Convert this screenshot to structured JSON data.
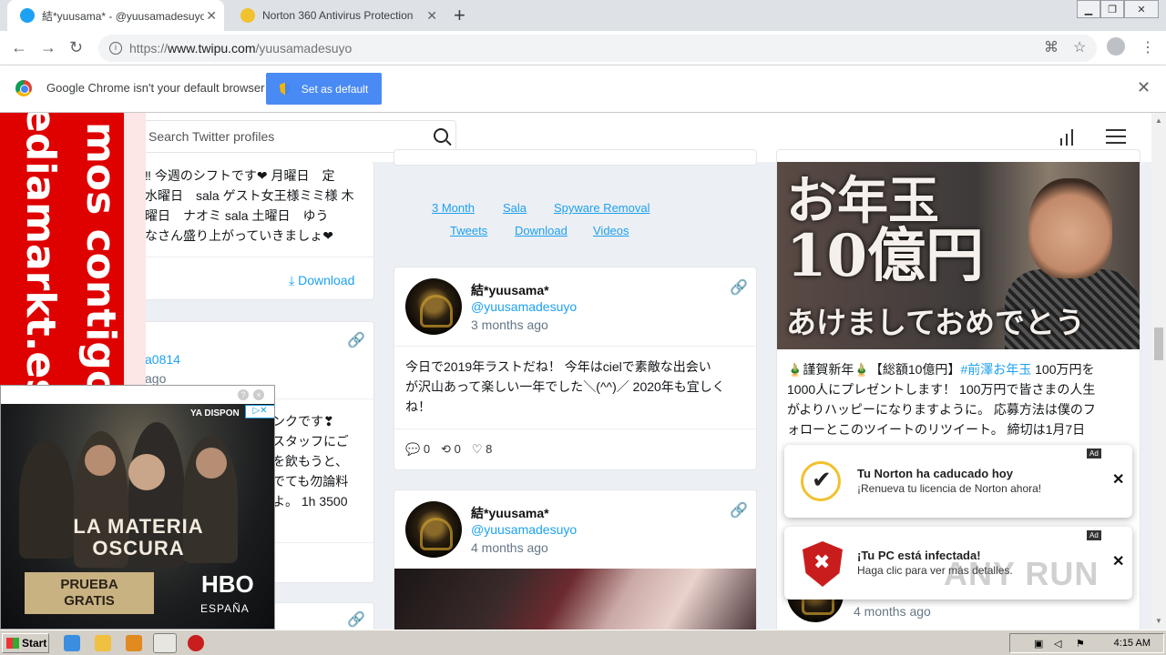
{
  "browser": {
    "tabs": [
      {
        "title": "結*yuusama* - @yuusamadesuyo T"
      },
      {
        "title": "Norton 360 Antivirus Protection"
      }
    ],
    "url": {
      "protocol": "https://",
      "host": "www.twipu.com",
      "path": "/yuusamadesuyo"
    },
    "infobar": {
      "message": "Google Chrome isn't your default browser",
      "button": "Set as default"
    }
  },
  "site": {
    "search_placeholder": "Search Twitter profiles",
    "nav_links_row1": [
      "3 Month",
      "Sala",
      "Spyware Removal"
    ],
    "nav_links_row2": [
      "Tweets",
      "Download",
      "Videos"
    ]
  },
  "left_column": {
    "tweet1_lines": [
      "‼ 今週のシフトです❤ 月曜日　定",
      "水曜日　sala ゲスト女王様ミミ様 木",
      "曜日　ナオミ sala 土曜日　ゆう",
      "なさん盛り上がっていきましょ❤"
    ],
    "download": "Download",
    "tweet2_handle_partial": "a0814",
    "tweet2_time_partial": "ago",
    "tweet2_lines": [
      "ンクです❣",
      "スタッフにご",
      "を飲もうと、",
      "でても勿論料",
      "よ。 1h 3500"
    ]
  },
  "middle_column": {
    "tweet1": {
      "name": "結*yuusama*",
      "handle": "@yuusamadesuyo",
      "time": "3 months ago",
      "lines": [
        "今日で2019年ラストだね！ 今年はcielで素敵な出会い",
        "が沢山あって楽しい一年でした＼(^^)／ 2020年も宜しく",
        "ね！"
      ],
      "replies": "0",
      "retweets": "0",
      "likes": "8"
    },
    "tweet2": {
      "name": "結*yuusama*",
      "handle": "@yuusamadesuyo",
      "time": "4 months ago"
    }
  },
  "right_column": {
    "image_text": {
      "line1": "お年玉",
      "line2": "10億円",
      "line3": "あけましておめでとう"
    },
    "tweet_lines_pre": [
      "🎍謹賀新年🎍【総額10億円】"
    ],
    "hashtag": "#前澤お年玉",
    "tweet_line1_post": " 100万円を",
    "tweet_lines": [
      "1000人にプレゼントします！ 100万円で皆さまの人生",
      "がよりハッピーになりますように。 応募方法は僕のフ",
      "ォローとこのツイートのリツイート。 締切は1月7日"
    ],
    "bottom_time": "4 months ago"
  },
  "ads": {
    "red_banner": {
      "line1": "ediamarkt.es",
      "line2": "mos contigo!"
    },
    "hbo": {
      "top_label": "YA DISPON",
      "title_line1": "LA MATERIA",
      "title_line2": "OSCURA",
      "cta_line1": "PRUEBA",
      "cta_line2": "GRATIS",
      "logo": "HBO",
      "logo_sub": "ESPAÑA"
    },
    "norton1": {
      "tag": "Ad",
      "title": "Tu Norton ha caducado hoy",
      "message": "¡Renueva tu licencia de Norton ahora!"
    },
    "norton2": {
      "tag": "Ad",
      "title": "¡Tu PC está infectada!",
      "message": "Haga clic para ver más detalles."
    },
    "watermark": "ANY RUN"
  },
  "taskbar": {
    "start": "Start",
    "clock": "4:15 AM"
  },
  "colors": {
    "twitter_blue": "#1da1f2",
    "chrome_blue": "#4a8af4",
    "mediamarkt_red": "#df0000"
  }
}
